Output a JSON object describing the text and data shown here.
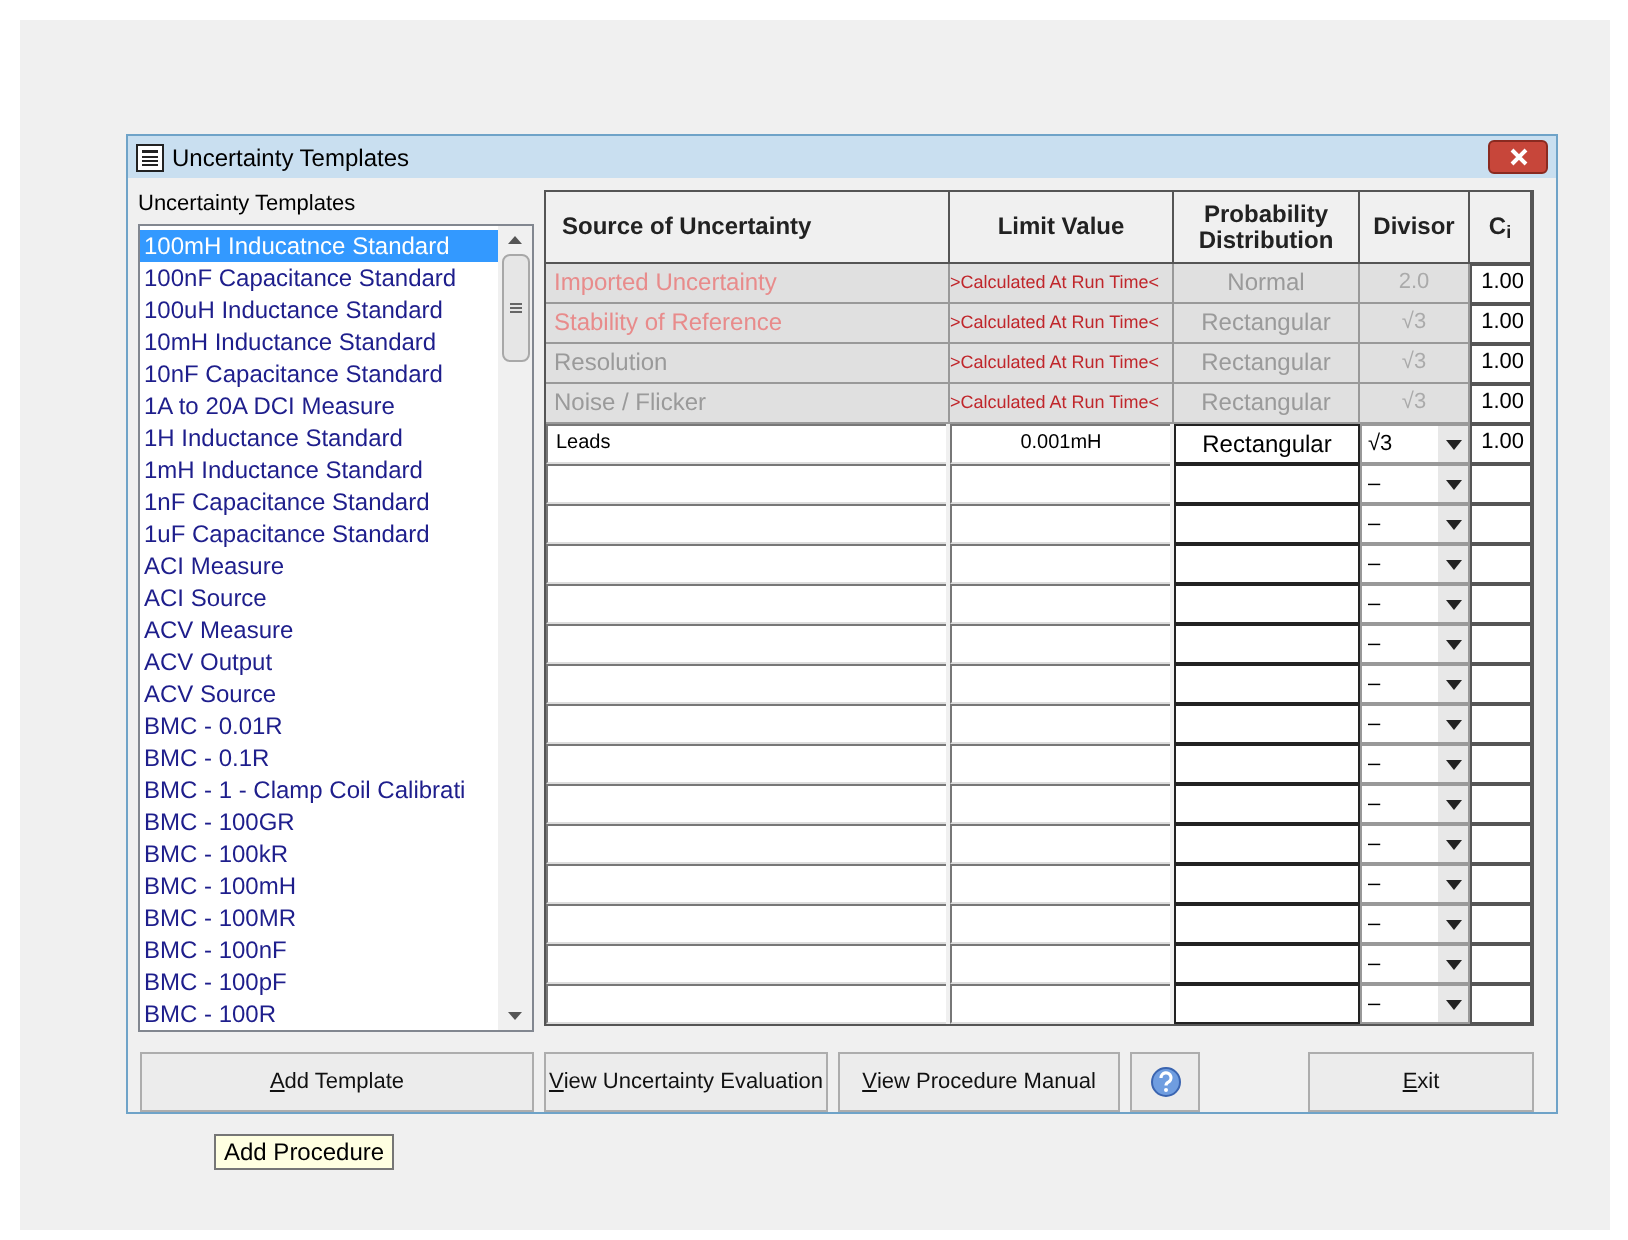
{
  "window": {
    "title": "Uncertainty Templates"
  },
  "templates": {
    "label": "Uncertainty Templates",
    "items": [
      {
        "label": "100mH Inducatnce Standard",
        "selected": true
      },
      {
        "label": "100nF Capacitance Standard",
        "selected": false
      },
      {
        "label": "100uH Inductance Standard",
        "selected": false
      },
      {
        "label": "10mH Inductance Standard",
        "selected": false
      },
      {
        "label": "10nF Capacitance Standard",
        "selected": false
      },
      {
        "label": "1A to 20A DCI Measure",
        "selected": false
      },
      {
        "label": "1H Inductance Standard",
        "selected": false
      },
      {
        "label": "1mH Inductance Standard",
        "selected": false
      },
      {
        "label": "1nF Capacitance Standard",
        "selected": false
      },
      {
        "label": "1uF Capacitance Standard",
        "selected": false
      },
      {
        "label": "ACI Measure",
        "selected": false
      },
      {
        "label": "ACI Source",
        "selected": false
      },
      {
        "label": "ACV Measure",
        "selected": false
      },
      {
        "label": "ACV Output",
        "selected": false
      },
      {
        "label": "ACV Source",
        "selected": false
      },
      {
        "label": "BMC - 0.01R",
        "selected": false
      },
      {
        "label": "BMC - 0.1R",
        "selected": false
      },
      {
        "label": "BMC - 1 - Clamp Coil Calibrati",
        "selected": false
      },
      {
        "label": "BMC - 100GR",
        "selected": false
      },
      {
        "label": "BMC - 100kR",
        "selected": false
      },
      {
        "label": "BMC - 100mH",
        "selected": false
      },
      {
        "label": "BMC - 100MR",
        "selected": false
      },
      {
        "label": "BMC - 100nF",
        "selected": false
      },
      {
        "label": "BMC - 100pF",
        "selected": false
      },
      {
        "label": "BMC - 100R",
        "selected": false
      }
    ]
  },
  "table": {
    "columns": [
      "Source of Uncertainty",
      "Limit Value",
      "Probability Distribution",
      "Divisor",
      "C"
    ],
    "ci_subscript": "i",
    "rows": [
      {
        "kind": "fixed",
        "source": "Imported Uncertainty",
        "color": "#e88b8b",
        "limit": ">Calculated At Run Time<",
        "distribution": "Normal",
        "divisor": "2.0",
        "ci": "1.00"
      },
      {
        "kind": "fixed",
        "source": "Stability of Reference",
        "color": "#e88b8b",
        "limit": ">Calculated At Run Time<",
        "distribution": "Rectangular",
        "divisor": "√3",
        "ci": "1.00"
      },
      {
        "kind": "fixed",
        "source": "Resolution",
        "color": "#9a9a9a",
        "limit": ">Calculated At Run Time<",
        "distribution": "Rectangular",
        "divisor": "√3",
        "ci": "1.00"
      },
      {
        "kind": "fixed",
        "source": "Noise / Flicker",
        "color": "#9a9a9a",
        "limit": ">Calculated At Run Time<",
        "distribution": "Rectangular",
        "divisor": "√3",
        "ci": "1.00"
      },
      {
        "kind": "entry",
        "source": "Leads",
        "limit": "0.001mH",
        "distribution": "Rectangular",
        "divisor": "√3",
        "ci": "1.00"
      },
      {
        "kind": "empty",
        "divisor": "–"
      },
      {
        "kind": "empty",
        "divisor": "–"
      },
      {
        "kind": "empty",
        "divisor": "–"
      },
      {
        "kind": "empty",
        "divisor": "–"
      },
      {
        "kind": "empty",
        "divisor": "–"
      },
      {
        "kind": "empty",
        "divisor": "–"
      },
      {
        "kind": "empty",
        "divisor": "–"
      },
      {
        "kind": "empty",
        "divisor": "–"
      },
      {
        "kind": "empty",
        "divisor": "–"
      },
      {
        "kind": "empty",
        "divisor": "–"
      },
      {
        "kind": "empty",
        "divisor": "–"
      },
      {
        "kind": "empty",
        "divisor": "–"
      },
      {
        "kind": "empty",
        "divisor": "–"
      },
      {
        "kind": "empty",
        "divisor": "–"
      }
    ]
  },
  "buttons": [
    {
      "kind": "text",
      "label": "Add Template",
      "mnemonic": true
    },
    {
      "kind": "text",
      "label": "View Uncertainty Evaluation",
      "mnemonic": true
    },
    {
      "kind": "text",
      "label": "View Procedure Manual",
      "mnemonic": true
    },
    {
      "kind": "help"
    },
    {
      "kind": "text",
      "label": "Exit",
      "mnemonic": true
    }
  ],
  "tooltip": "Add Procedure"
}
